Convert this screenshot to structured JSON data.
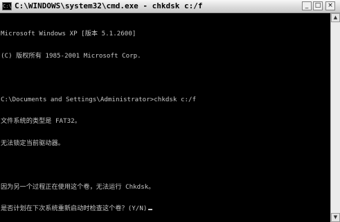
{
  "window": {
    "title": "C:\\WINDOWS\\system32\\cmd.exe - chkdsk c:/f",
    "icon_text": "C:\\",
    "controls": {
      "minimize": "_",
      "maximize": "□",
      "close": "×"
    }
  },
  "console": {
    "lines": [
      "Microsoft Windows XP [版本 5.1.2600]",
      "(C) 版权所有 1985-2001 Microsoft Corp.",
      "",
      "C:\\Documents and Settings\\Administrator>chkdsk c:/f",
      "文件系统的类型是 FAT32。",
      "无法锁定当前驱动器。",
      "",
      "因为另一个过程正在使用这个卷，无法运行 Chkdsk。",
      "是否计划在下次系统重新启动时检查这个卷？(Y/N)"
    ]
  },
  "scrollbar": {
    "up": "▲",
    "down": "▼"
  },
  "colors": {
    "background": "#000000",
    "text": "#c8c8c8",
    "titlebar": "#d9d9d9"
  }
}
